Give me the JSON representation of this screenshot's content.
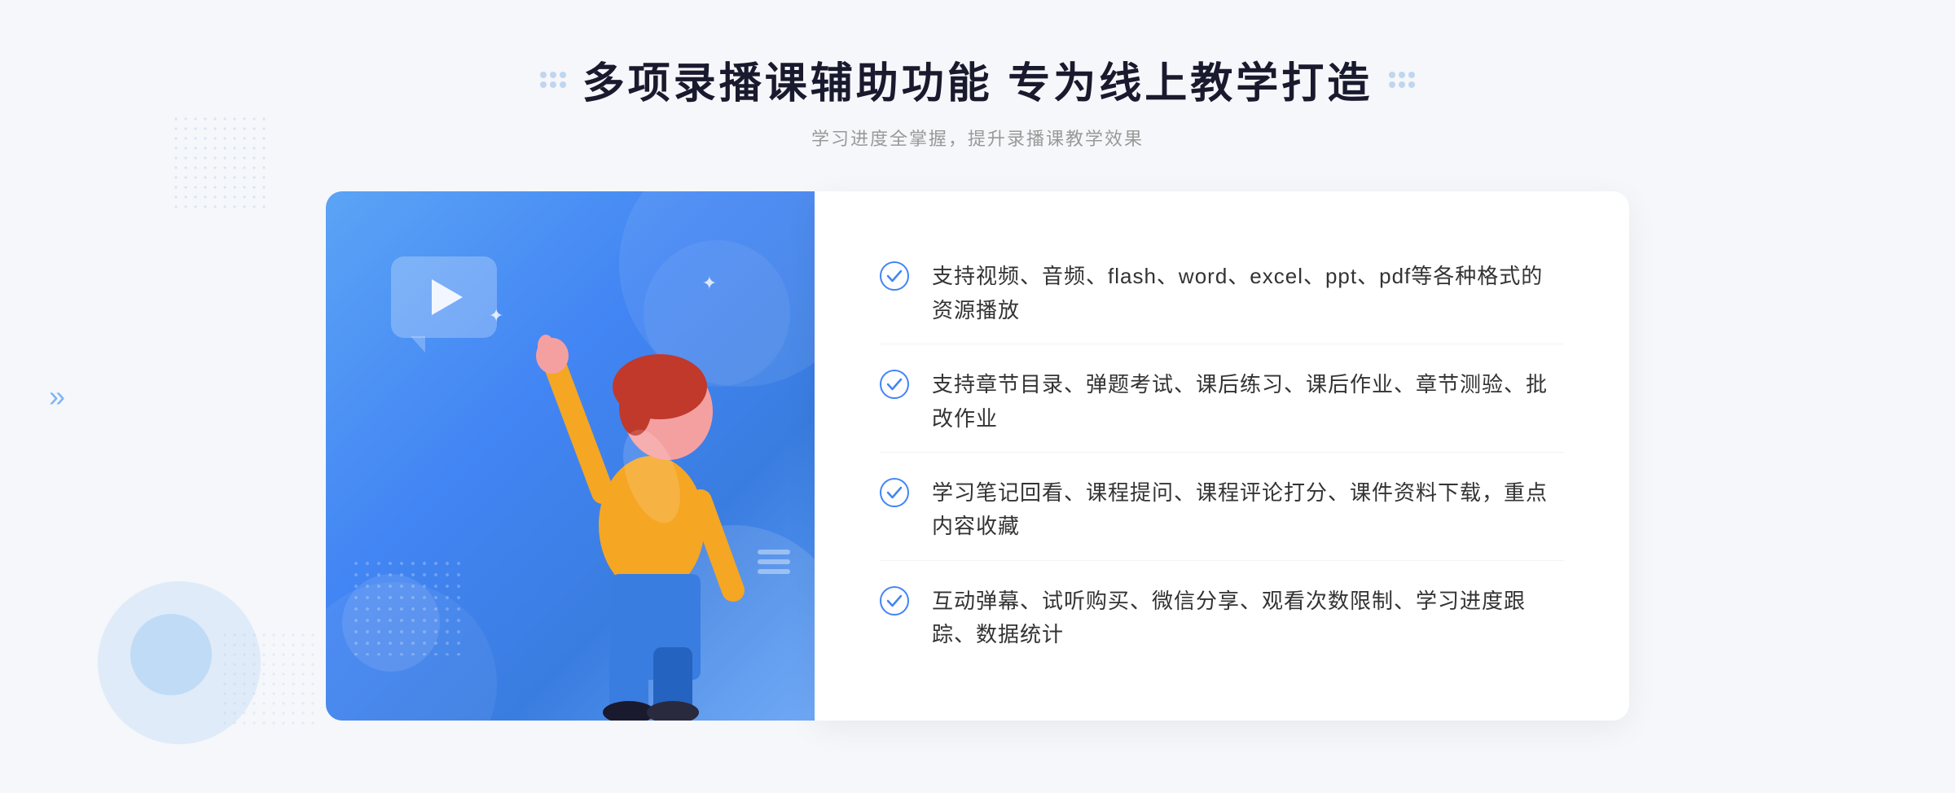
{
  "header": {
    "title": "多项录播课辅助功能 专为线上教学打造",
    "subtitle": "学习进度全掌握，提升录播课教学效果"
  },
  "features": [
    {
      "id": 1,
      "text": "支持视频、音频、flash、word、excel、ppt、pdf等各种格式的资源播放"
    },
    {
      "id": 2,
      "text": "支持章节目录、弹题考试、课后练习、课后作业、章节测验、批改作业"
    },
    {
      "id": 3,
      "text": "学习笔记回看、课程提问、课程评论打分、课件资料下载，重点内容收藏"
    },
    {
      "id": 4,
      "text": "互动弹幕、试听购买、微信分享、观看次数限制、学习进度跟踪、数据统计"
    }
  ],
  "colors": {
    "primary_blue": "#4285f4",
    "light_blue": "#5ba4f5",
    "text_dark": "#1a1a2e",
    "text_gray": "#999999",
    "text_body": "#333333",
    "check_color": "#4285f4",
    "bg": "#f5f7fa"
  },
  "decorations": {
    "arrow_char": "»",
    "sparkle_char": "✦"
  }
}
